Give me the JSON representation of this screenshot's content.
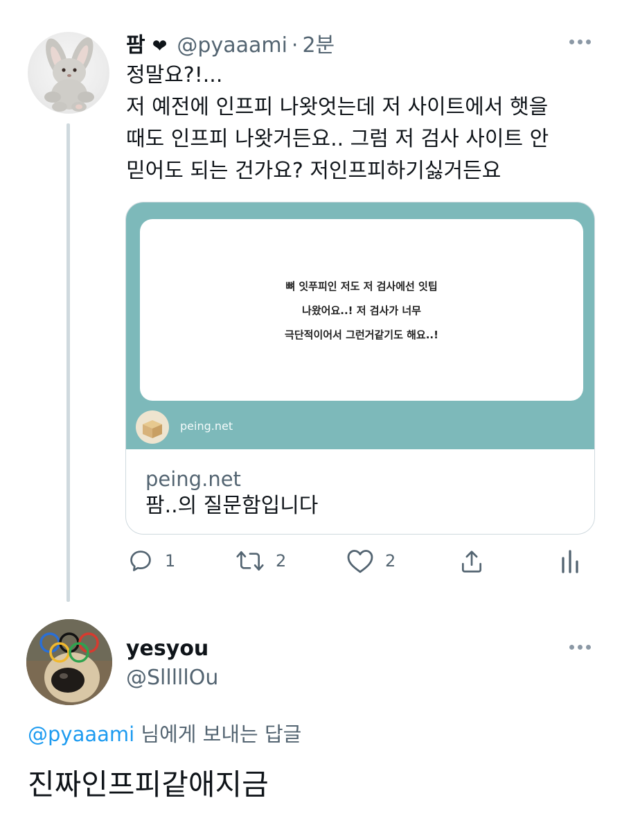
{
  "tweet": {
    "display_name": "팜",
    "heart": "❤",
    "handle": "@pyaaami",
    "separator": "·",
    "time": "2분",
    "lines": [
      "정말요?!...",
      "저 예전에 인프피 나왓엇는데 저 사이트에서 햇을",
      "때도 인프피 나왓거든요.. 그럼 저 검사 사이트 안",
      "믿어도 되는 건가요? 저인프피하기싫거든요"
    ],
    "card": {
      "image_lines": [
        "뼈 잇푸피인 저도 저 검사에선 잇팁",
        "나왔어요..! 저 검사가 너무",
        "극단적이어서 그런거같기도 해요..!"
      ],
      "image_site": "peing.net",
      "domain": "peing.net",
      "title": "팜..의 질문함입니다"
    },
    "actions": {
      "reply_count": "1",
      "retweet_count": "2",
      "like_count": "2"
    }
  },
  "reply": {
    "display_name": "yesyou",
    "handle": "@SlllllOu",
    "replying_to_mention": "@pyaaami",
    "replying_to_suffix": " 님에게 보내는 답글",
    "text": "진짜인프피같애지금"
  },
  "colors": {
    "accent": "#1d9bf0",
    "secondary_text": "#536471",
    "card_bg": "#7db9ba",
    "thread_line": "#cfd9de"
  }
}
